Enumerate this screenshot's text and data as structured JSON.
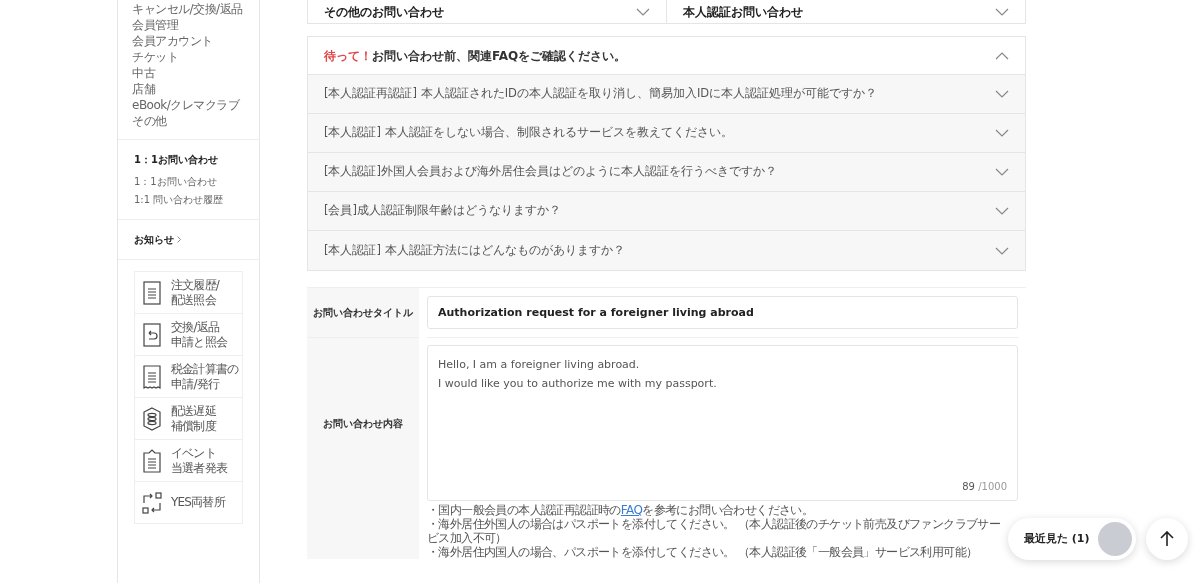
{
  "sidebar": {
    "links": [
      "キャンセル/交換/返品",
      "会員管理",
      "会員アカウント",
      "チケット",
      "中古",
      "店舗",
      "eBook/クレマクラブ",
      "その他"
    ],
    "inquiry_section": {
      "title": "1：1お問い合わせ",
      "links": [
        "1：1お問い合わせ",
        "1:1 問い合わせ履歴"
      ]
    },
    "notice_link": "お知らせ",
    "shortcuts": [
      {
        "kind": "list",
        "lines": [
          "注文履歴/",
          "配送照会"
        ]
      },
      {
        "kind": "return",
        "lines": [
          "交換/返品",
          "申請と照会"
        ]
      },
      {
        "kind": "receipt",
        "lines": [
          "税金計算書の",
          "申請/発行"
        ]
      },
      {
        "kind": "coins",
        "lines": [
          "配送遅延",
          "補償制度"
        ]
      },
      {
        "kind": "clipboard",
        "lines": [
          "イベント",
          "当選者発表"
        ]
      },
      {
        "kind": "exchange",
        "lines": [
          "YES両替所"
        ]
      }
    ]
  },
  "category_selects": [
    "その他のお問い合わせ",
    "本人認証お問い合わせ"
  ],
  "faq": {
    "warning": "待って！",
    "title": "お問い合わせ前、関連FAQをご確認ください。",
    "expanded": true,
    "items": [
      {
        "text": "[本人認証再認証] 本人認証されたIDの本人認証を取り消し、簡易加入IDに本人認証処理が可能ですか？",
        "expanded": false
      },
      {
        "text": "[本人認証] 本人認証をしない場合、制限されるサービスを教えてください。",
        "expanded": false
      },
      {
        "text": "[本人認証]外国人会員および海外居住会員はどのように本人認証を行うべきですか？",
        "expanded": false
      },
      {
        "text": "[会員]成人認証制限年齢はどうなりますか？",
        "expanded": false
      },
      {
        "text": "[本人認証] 本人認証方法にはどんなものがありますか？",
        "expanded": false
      }
    ]
  },
  "form": {
    "title_label": "お問い合わせタイトル",
    "title_value": "Authorization request for a foreigner living abroad",
    "content_label": "お問い合わせ内容",
    "content_value": "Hello, I am a foreigner living abroad.\nI would like you to authorize me with my passport.",
    "count": "89",
    "max": "/1000"
  },
  "notes": [
    {
      "before": "・国内一般会員の本人認証再認証時の",
      "link": "FAQ",
      "after": "を参考にお問い合わせください。"
    },
    {
      "before": "・海外居住外国人の場合はパスポートを添付してください。 （本人認証後のチケット前売及びファンクラブサービス加入不可）"
    },
    {
      "before": "・海外居住内国人の場合、パスポートを添付してください。 （本人認証後「一般会員」サービス利用可能）"
    }
  ],
  "recently_viewed": "最近見た (1)"
}
